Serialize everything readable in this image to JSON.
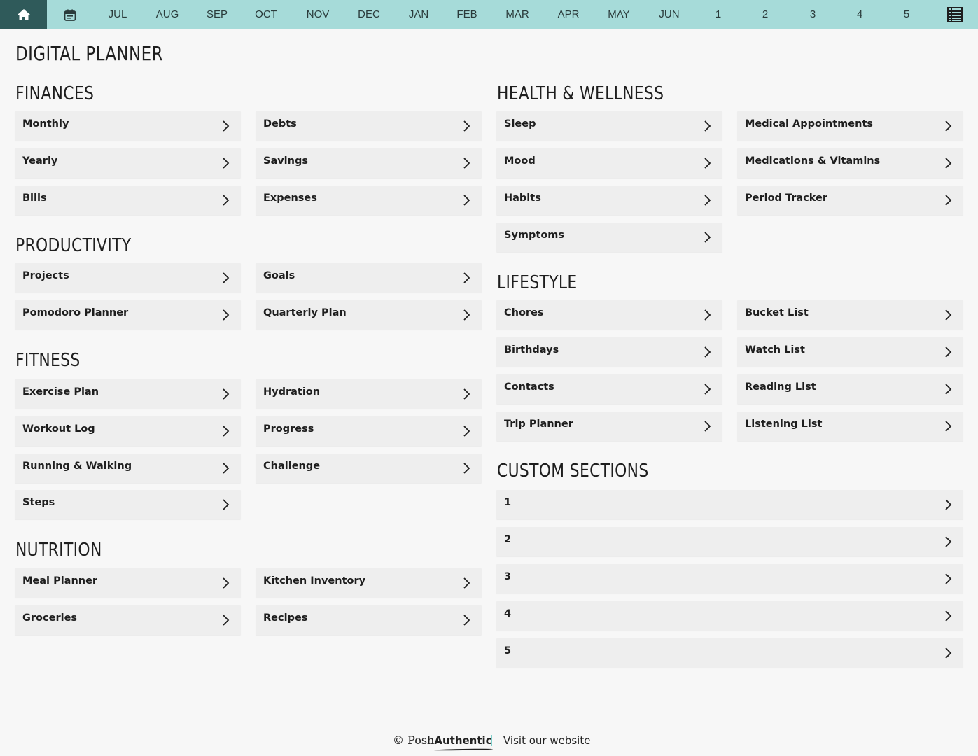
{
  "nav": {
    "home_icon": "home-icon",
    "calendar_icon": "calendar-icon",
    "months": [
      "JUL",
      "AUG",
      "SEP",
      "OCT",
      "NOV",
      "DEC",
      "JAN",
      "FEB",
      "MAR",
      "APR",
      "MAY",
      "JUN"
    ],
    "numbers": [
      "1",
      "2",
      "3",
      "4",
      "5"
    ],
    "menu_icon": "list-icon",
    "bar_color": "#a6dbd9",
    "home_color": "#2f5a5a"
  },
  "title": "DIGITAL PLANNER",
  "sections": {
    "finances": {
      "title": "FINANCES",
      "items": [
        "Monthly",
        "Debts",
        "Yearly",
        "Savings",
        "Bills",
        "Expenses"
      ]
    },
    "productivity": {
      "title": "PRODUCTIVITY",
      "items": [
        "Projects",
        "Goals",
        "Pomodoro Planner",
        "Quarterly Plan"
      ]
    },
    "fitness": {
      "title": "FITNESS",
      "items": [
        "Exercise Plan",
        "Hydration",
        "Workout Log",
        "Progress",
        "Running & Walking",
        "Challenge",
        "Steps"
      ]
    },
    "nutrition": {
      "title": "NUTRITION",
      "items": [
        "Meal Planner",
        "Kitchen Inventory",
        "Groceries",
        "Recipes"
      ]
    },
    "health": {
      "title": "HEALTH & WELLNESS",
      "items": [
        "Sleep",
        "Medical Appointments",
        "Mood",
        "Medications & Vitamins",
        "Habits",
        "Period Tracker",
        "Symptoms"
      ]
    },
    "lifestyle": {
      "title": "LIFESTYLE",
      "items": [
        "Chores",
        "Bucket List",
        "Birthdays",
        "Watch List",
        "Contacts",
        "Reading List",
        "Trip Planner",
        "Listening List"
      ]
    },
    "custom": {
      "title": "CUSTOM SECTIONS",
      "items": [
        "1",
        "2",
        "3",
        "4",
        "5"
      ]
    }
  },
  "footer": {
    "copyright": "© Posh",
    "brand": "Authentic",
    "link": "Visit our website"
  }
}
